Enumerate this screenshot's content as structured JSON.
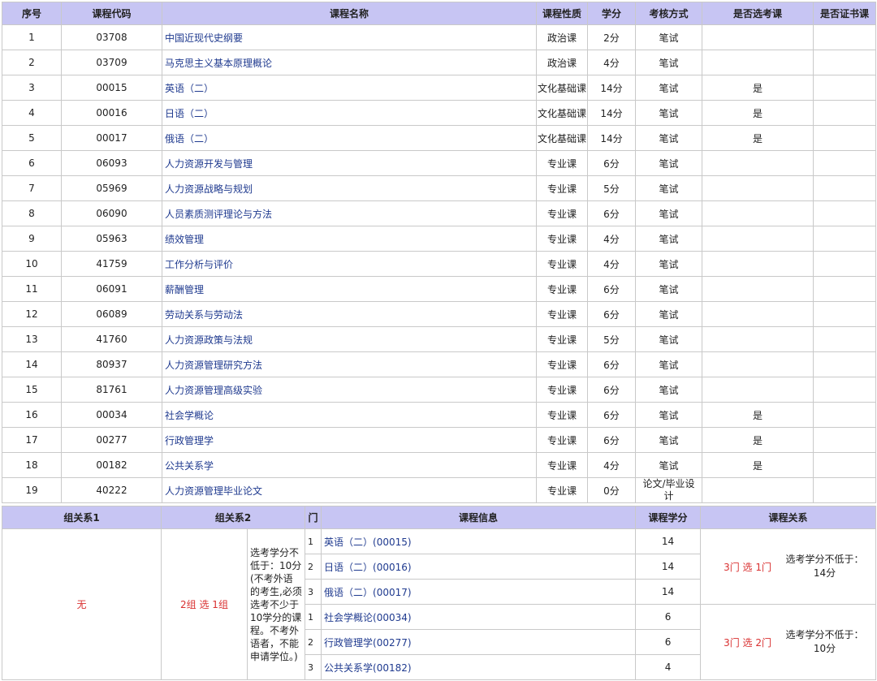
{
  "course_table": {
    "headers": [
      "序号",
      "课程代码",
      "课程名称",
      "课程性质",
      "学分",
      "考核方式",
      "是否选考课",
      "是否证书课"
    ],
    "rows": [
      {
        "no": "1",
        "code": "03708",
        "name": "中国近现代史纲要",
        "type": "政治课",
        "credit": "2分",
        "exam": "笔试",
        "elective": "",
        "cert": ""
      },
      {
        "no": "2",
        "code": "03709",
        "name": "马克思主义基本原理概论",
        "type": "政治课",
        "credit": "4分",
        "exam": "笔试",
        "elective": "",
        "cert": ""
      },
      {
        "no": "3",
        "code": "00015",
        "name": "英语（二）",
        "type": "文化基础课",
        "credit": "14分",
        "exam": "笔试",
        "elective": "是",
        "cert": ""
      },
      {
        "no": "4",
        "code": "00016",
        "name": "日语（二）",
        "type": "文化基础课",
        "credit": "14分",
        "exam": "笔试",
        "elective": "是",
        "cert": ""
      },
      {
        "no": "5",
        "code": "00017",
        "name": "俄语（二）",
        "type": "文化基础课",
        "credit": "14分",
        "exam": "笔试",
        "elective": "是",
        "cert": ""
      },
      {
        "no": "6",
        "code": "06093",
        "name": "人力资源开发与管理",
        "type": "专业课",
        "credit": "6分",
        "exam": "笔试",
        "elective": "",
        "cert": ""
      },
      {
        "no": "7",
        "code": "05969",
        "name": "人力资源战略与规划",
        "type": "专业课",
        "credit": "5分",
        "exam": "笔试",
        "elective": "",
        "cert": ""
      },
      {
        "no": "8",
        "code": "06090",
        "name": "人员素质测评理论与方法",
        "type": "专业课",
        "credit": "6分",
        "exam": "笔试",
        "elective": "",
        "cert": ""
      },
      {
        "no": "9",
        "code": "05963",
        "name": "绩效管理",
        "type": "专业课",
        "credit": "4分",
        "exam": "笔试",
        "elective": "",
        "cert": ""
      },
      {
        "no": "10",
        "code": "41759",
        "name": "工作分析与评价",
        "type": "专业课",
        "credit": "4分",
        "exam": "笔试",
        "elective": "",
        "cert": ""
      },
      {
        "no": "11",
        "code": "06091",
        "name": "薪酬管理",
        "type": "专业课",
        "credit": "6分",
        "exam": "笔试",
        "elective": "",
        "cert": ""
      },
      {
        "no": "12",
        "code": "06089",
        "name": "劳动关系与劳动法",
        "type": "专业课",
        "credit": "6分",
        "exam": "笔试",
        "elective": "",
        "cert": ""
      },
      {
        "no": "13",
        "code": "41760",
        "name": "人力资源政策与法规",
        "type": "专业课",
        "credit": "5分",
        "exam": "笔试",
        "elective": "",
        "cert": ""
      },
      {
        "no": "14",
        "code": "80937",
        "name": "人力资源管理研究方法",
        "type": "专业课",
        "credit": "6分",
        "exam": "笔试",
        "elective": "",
        "cert": ""
      },
      {
        "no": "15",
        "code": "81761",
        "name": "人力资源管理高级实验",
        "type": "专业课",
        "credit": "6分",
        "exam": "笔试",
        "elective": "",
        "cert": ""
      },
      {
        "no": "16",
        "code": "00034",
        "name": "社会学概论",
        "type": "专业课",
        "credit": "6分",
        "exam": "笔试",
        "elective": "是",
        "cert": ""
      },
      {
        "no": "17",
        "code": "00277",
        "name": "行政管理学",
        "type": "专业课",
        "credit": "6分",
        "exam": "笔试",
        "elective": "是",
        "cert": ""
      },
      {
        "no": "18",
        "code": "00182",
        "name": "公共关系学",
        "type": "专业课",
        "credit": "4分",
        "exam": "笔试",
        "elective": "是",
        "cert": ""
      },
      {
        "no": "19",
        "code": "40222",
        "name": "人力资源管理毕业论文",
        "type": "专业课",
        "credit": "0分",
        "exam": "论文/毕业设计",
        "elective": "",
        "cert": ""
      }
    ]
  },
  "group_table": {
    "headers": [
      "组关系1",
      "组关系2",
      "门",
      "课程信息",
      "课程学分",
      "课程关系"
    ],
    "rel1": "无",
    "rel2": "2组 选 1组",
    "note": "选考学分不低于：10分 (不考外语的考生,必须选考不少于10学分的课程。不考外语者，不能申请学位。)",
    "groups": [
      {
        "relation": "3门 选 1门",
        "relation_note": "选考学分不低于：14分",
        "courses": [
          {
            "idx": "1",
            "info": "英语（二）(00015)",
            "credit": "14"
          },
          {
            "idx": "2",
            "info": "日语（二）(00016)",
            "credit": "14"
          },
          {
            "idx": "3",
            "info": "俄语（二）(00017)",
            "credit": "14"
          }
        ]
      },
      {
        "relation": "3门 选 2门",
        "relation_note": "选考学分不低于：10分",
        "courses": [
          {
            "idx": "1",
            "info": "社会学概论(00034)",
            "credit": "6"
          },
          {
            "idx": "2",
            "info": "行政管理学(00277)",
            "credit": "6"
          },
          {
            "idx": "3",
            "info": "公共关系学(00182)",
            "credit": "4"
          }
        ]
      }
    ]
  }
}
